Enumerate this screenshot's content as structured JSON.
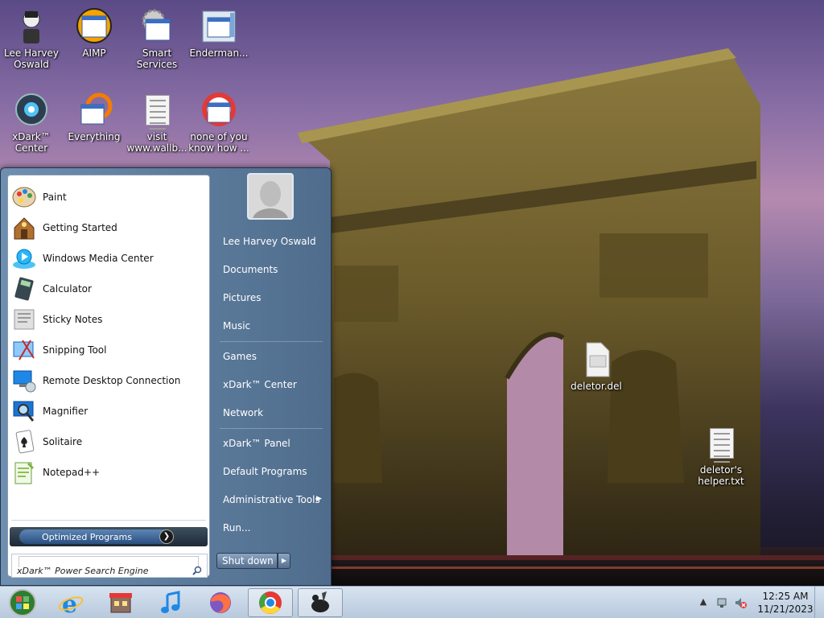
{
  "desktop_icons": [
    {
      "name": "lee-harvey-oswald",
      "label": "Lee Harvey Oswald"
    },
    {
      "name": "aimp",
      "label": "AIMP"
    },
    {
      "name": "smart-services",
      "label": "Smart Services"
    },
    {
      "name": "enderman",
      "label": "Enderman..."
    },
    {
      "name": "xdark-center",
      "label": "xDark™ Center"
    },
    {
      "name": "everything",
      "label": "Everything"
    },
    {
      "name": "visit-wallb",
      "label": "visit www.wallb..."
    },
    {
      "name": "none-of-you",
      "label": "none of you know how ..."
    },
    {
      "name": "deletor-del",
      "label": "deletor.del"
    },
    {
      "name": "deletors-helper",
      "label": "deletor's helper.txt"
    }
  ],
  "start_menu": {
    "programs": [
      {
        "label": "Paint",
        "icon": "paint-icon"
      },
      {
        "label": "Getting Started",
        "icon": "getting-started-icon"
      },
      {
        "label": "Windows Media Center",
        "icon": "media-center-icon"
      },
      {
        "label": "Calculator",
        "icon": "calculator-icon"
      },
      {
        "label": "Sticky Notes",
        "icon": "sticky-notes-icon"
      },
      {
        "label": "Snipping Tool",
        "icon": "snipping-tool-icon"
      },
      {
        "label": "Remote Desktop Connection",
        "icon": "remote-desktop-icon"
      },
      {
        "label": "Magnifier",
        "icon": "magnifier-icon"
      },
      {
        "label": "Solitaire",
        "icon": "solitaire-icon"
      },
      {
        "label": "Notepad++",
        "icon": "notepadpp-icon"
      }
    ],
    "optimized_programs": "Optimized Programs",
    "search_placeholder": "xDark™ Power Search Engine",
    "right_links": [
      "Lee Harvey Oswald",
      "Documents",
      "Pictures",
      "Music",
      "Games",
      "xDark™ Center",
      "Network",
      "xDark™ Panel",
      "Default Programs",
      "Administrative Tools",
      "Run..."
    ],
    "shutdown_label": "Shut down"
  },
  "taskbar": {
    "time": "12:25 AM",
    "date": "11/21/2023"
  }
}
